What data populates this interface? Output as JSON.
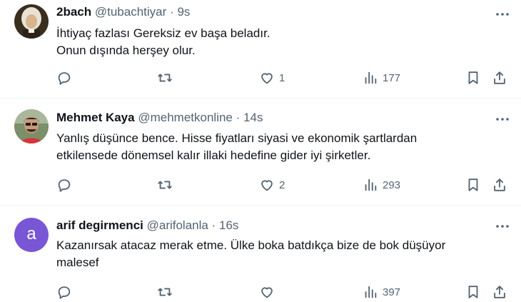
{
  "tweets": [
    {
      "name": "2bach",
      "handle": "@tubachtiyar",
      "dot": "·",
      "time": "9s",
      "lines": [
        "İhtiyaç fazlası Gereksiz ev başa beladır.",
        "Onun dışında herşey olur."
      ],
      "likes": "1",
      "views": "177",
      "avatar": "portrait-photo"
    },
    {
      "name": "Mehmet Kaya",
      "handle": "@mehmetkonline",
      "dot": "·",
      "time": "14s",
      "lines": [
        "Yanlış düşünce bence. Hisse fiyatları siyasi ve ekonomik şartlardan",
        "etkilensede dönemsel kalır illaki hedefine gider iyi şirketler."
      ],
      "likes": "2",
      "views": "293",
      "avatar": "person-photo"
    },
    {
      "name": "arif degirmenci",
      "handle": "@arifolanla",
      "dot": "·",
      "time": "16s",
      "lines": [
        "Kazanırsak atacaz merak etme. Ülke boka batdıkça bize de bok düşüyor",
        "malesef"
      ],
      "likes": "",
      "views": "397",
      "avatar_letter": "a",
      "avatar_color": "#7856d6"
    }
  ],
  "colors": {
    "text": "#0f1419",
    "secondary": "#536471",
    "divider": "#eff3f4"
  }
}
